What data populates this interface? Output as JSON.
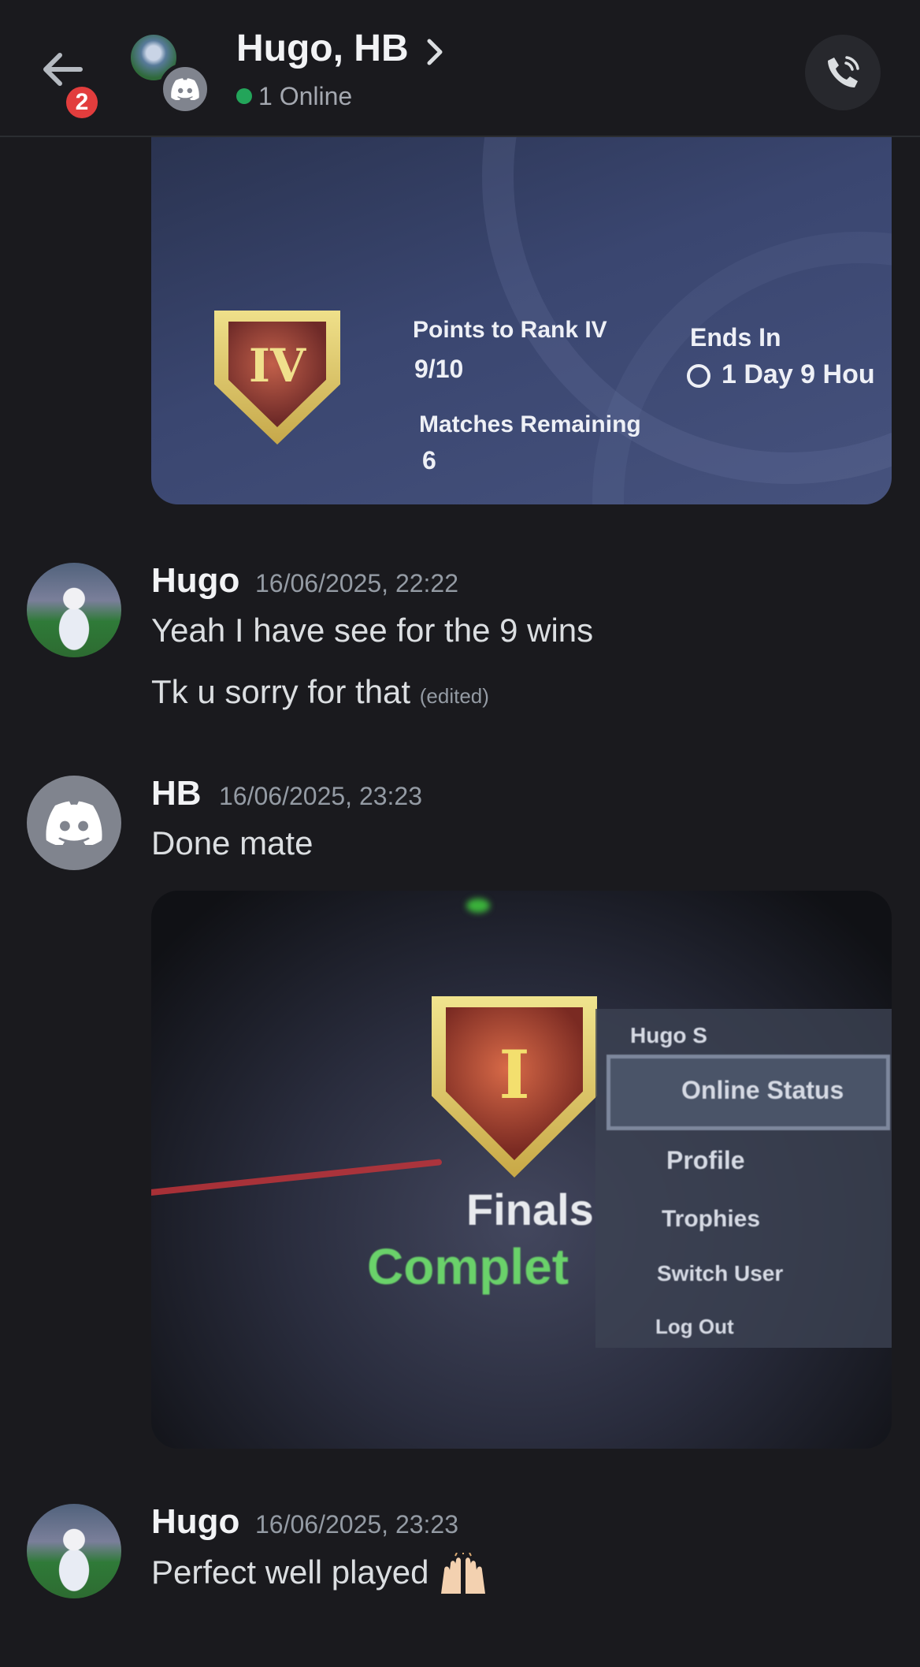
{
  "header": {
    "back_badge": "2",
    "title": "Hugo, HB",
    "status": "1 Online"
  },
  "attachment1": {
    "rank_badge": "IV",
    "points_label": "Points to Rank IV",
    "points_value": "9/10",
    "ends_label": "Ends In",
    "ends_value": "1 Day 9 Hou",
    "matches_label": "Matches Remaining",
    "matches_value": "6"
  },
  "messages": [
    {
      "author": "Hugo",
      "timestamp": "16/06/2025, 22:22",
      "lines": [
        "Yeah I have see for the 9 wins",
        "Tk u sorry for that"
      ],
      "edited_label": "(edited)"
    },
    {
      "author": "HB",
      "timestamp": "16/06/2025, 23:23",
      "lines": [
        "Done mate"
      ]
    },
    {
      "author": "Hugo",
      "timestamp": "16/06/2025, 23:23",
      "lines": [
        "Perfect well played"
      ],
      "emoji": "raising-hands-icon"
    }
  ],
  "attachment2": {
    "rank_badge": "I",
    "finals_text": "Finals",
    "complete_text": "Complet",
    "menu_user": "Hugo S",
    "menu_items": [
      "Online Status",
      "Profile",
      "Trophies",
      "Switch User",
      "Log Out"
    ]
  },
  "colors": {
    "background": "#1a1a1e",
    "online": "#23a55a",
    "badge": "#e23d3d",
    "discord_avatar": "#80848e"
  }
}
